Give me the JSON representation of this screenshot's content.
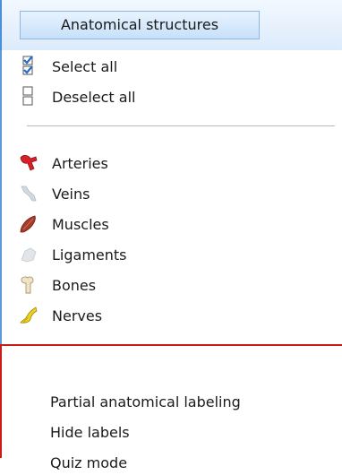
{
  "menu": {
    "title": "Anatomical structures",
    "selection": [
      {
        "label": "Select all",
        "icon": "checkbox-checked-icon"
      },
      {
        "label": "Deselect all",
        "icon": "checkbox-unchecked-icon"
      }
    ],
    "structures": [
      {
        "label": "Arteries",
        "icon": "artery-icon",
        "color": "#d8202a"
      },
      {
        "label": "Veins",
        "icon": "vein-icon",
        "color": "#c9d3db"
      },
      {
        "label": "Muscles",
        "icon": "muscle-icon",
        "color": "#a63b2b"
      },
      {
        "label": "Ligaments",
        "icon": "ligament-icon",
        "color": "#d9dde2"
      },
      {
        "label": "Bones",
        "icon": "bone-icon",
        "color": "#e6d9b8"
      },
      {
        "label": "Nerves",
        "icon": "nerve-icon",
        "color": "#f0d21a"
      }
    ],
    "options": [
      {
        "label": "Partial anatomical labeling"
      },
      {
        "label": "Hide labels"
      },
      {
        "label": "Quiz mode"
      }
    ]
  },
  "colors": {
    "accent_border": "#4d8fd6",
    "highlight_border": "#cc1b1b"
  }
}
